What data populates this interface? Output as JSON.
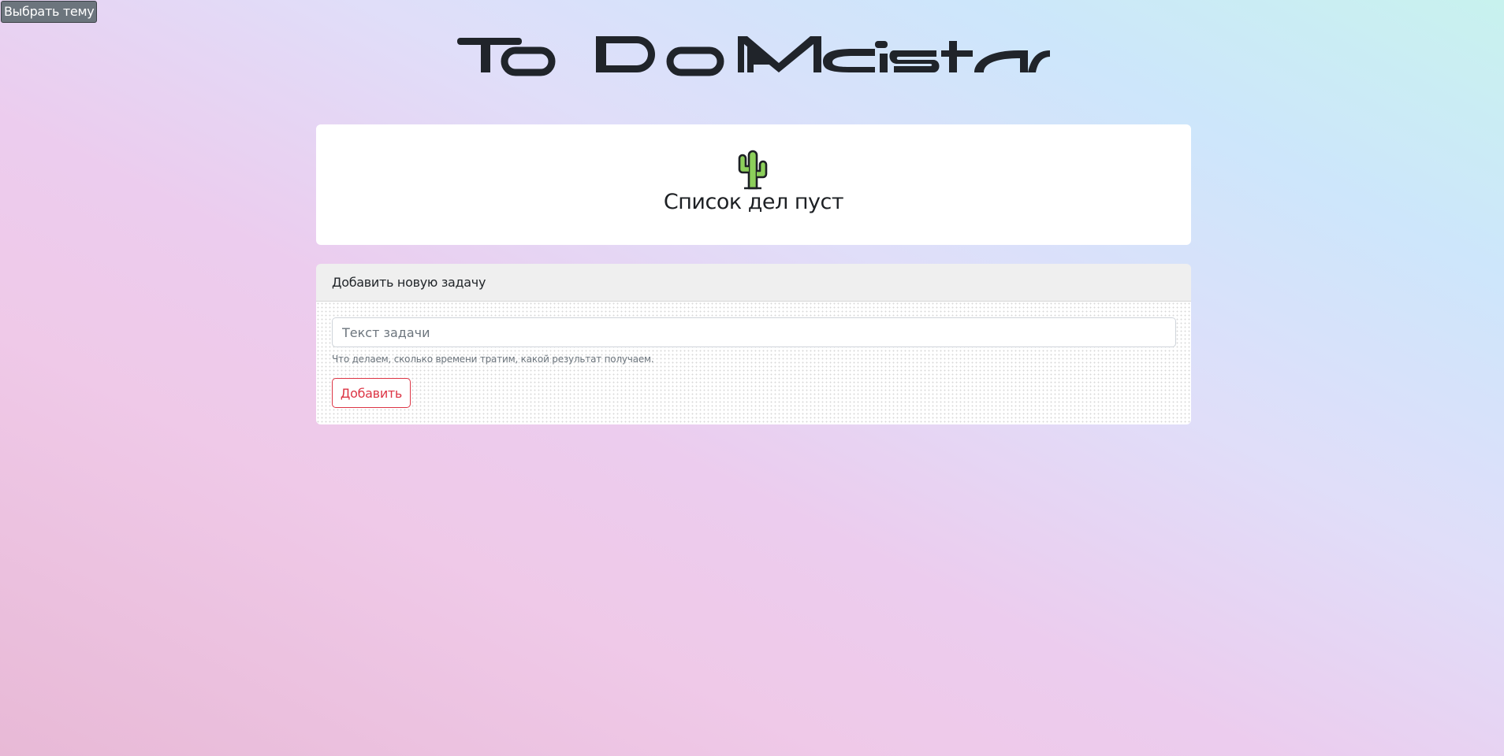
{
  "theme_button": {
    "label": "Выбрать тему"
  },
  "logo": {
    "text": "To Do Meister"
  },
  "empty_state": {
    "icon": "cactus-icon",
    "title": "Список дел пуст"
  },
  "add_task": {
    "header": "Добавить новую задачу",
    "input_placeholder": "Текст задачи",
    "input_value": "",
    "hint": "Что делаем, сколько времени тратим, какой результат получаем.",
    "submit_label": "Добавить"
  },
  "colors": {
    "accent": "#dc3545",
    "theme_button_bg": "#6c757d",
    "text": "#212529",
    "card_header_bg": "#efefef",
    "cactus": "#7ec850"
  }
}
